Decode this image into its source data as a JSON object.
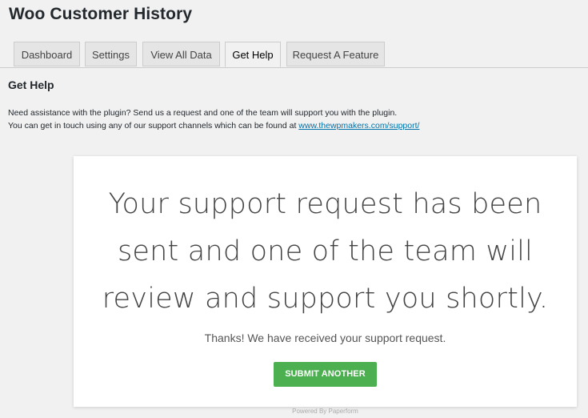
{
  "header": {
    "title": "Woo Customer History"
  },
  "tabs": [
    {
      "label": "Dashboard",
      "active": false
    },
    {
      "label": "Settings",
      "active": false
    },
    {
      "label": "View All Data",
      "active": false
    },
    {
      "label": "Get Help",
      "active": true
    },
    {
      "label": "Request A Feature",
      "active": false
    }
  ],
  "section": {
    "heading": "Get Help",
    "line1": "Need assistance with the plugin? Send us a request and one of the team will support you with the plugin.",
    "line2_prefix": "You can get in touch using any of our support channels which can be found at ",
    "link_text": "www.thewpmakers.com/support/"
  },
  "card": {
    "message_line1": "Your support request has been",
    "message_line2": "sent and one of the team will",
    "message_line3": "review and support you shortly.",
    "thanks": "Thanks! We have received your support request.",
    "button_label": "SUBMIT ANOTHER"
  },
  "footer": {
    "powered_by": "Powered By Paperform"
  },
  "colors": {
    "accent_button": "#4caf50",
    "link": "#0073aa"
  }
}
